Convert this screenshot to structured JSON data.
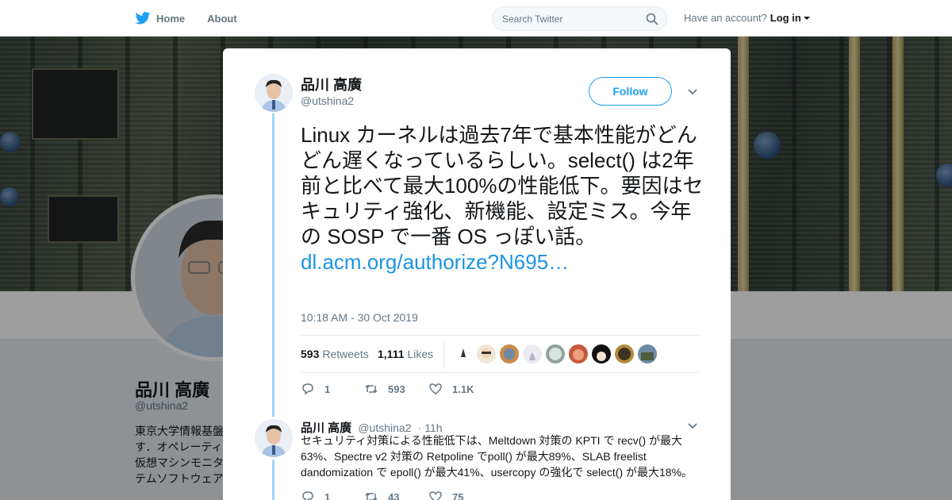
{
  "nav": {
    "home_label": "Home",
    "about_label": "About",
    "search_placeholder": "Search Twitter",
    "have_account": "Have an account?",
    "login_label": "Log in"
  },
  "profile": {
    "name": "品川 高廣",
    "handle": "@utshina2",
    "bio_lines": [
      "東京大学情報基盤",
      "す．オペレーティ",
      "仮想マシンモニタ",
      "テムソフトウェア"
    ]
  },
  "tweet": {
    "author_name": "品川 高廣",
    "author_handle": "@utshina2",
    "follow_label": "Follow",
    "text": "Linux カーネルは過去7年で基本性能がどんどん遅くなっているらしい。select() は2年前と比べて最大100%の性能低下。要因はセキュリティ強化、新機能、設定ミス。今年の SOSP で一番 OS っぽい話。",
    "link_text": "dl.acm.org/authorize?N695…",
    "timestamp": "10:18 AM - 30 Oct 2019",
    "retweets_count": "593",
    "retweets_label": "Retweets",
    "likes_count": "1,111",
    "likes_label": "Likes",
    "reply_count": "1",
    "retweet_action_count": "593",
    "like_action_count": "1.1K"
  },
  "reply": {
    "author_name": "品川 高廣",
    "author_handle": "@utshina2",
    "time": "· 11h",
    "text": "セキュリティ対策による性能低下は、Meltdown 対策の KPTI で recv() が最大63%、Spectre v2 対策の Retpoline でpoll() が最大89%、SLAB freelist dandomization で epoll() が最大41%、usercopy の強化で select() が最大18%。",
    "reply_count": "1",
    "retweet_count": "43",
    "like_count": "75"
  },
  "colors": {
    "accent": "#1da1f2",
    "link": "#1b95e0",
    "thread_line": "#a3d6f5",
    "muted_text": "#657786"
  },
  "icons": [
    "twitter-bird-icon",
    "search-icon",
    "close-icon",
    "chevron-down-icon",
    "reply-icon",
    "retweet-icon",
    "like-icon"
  ]
}
